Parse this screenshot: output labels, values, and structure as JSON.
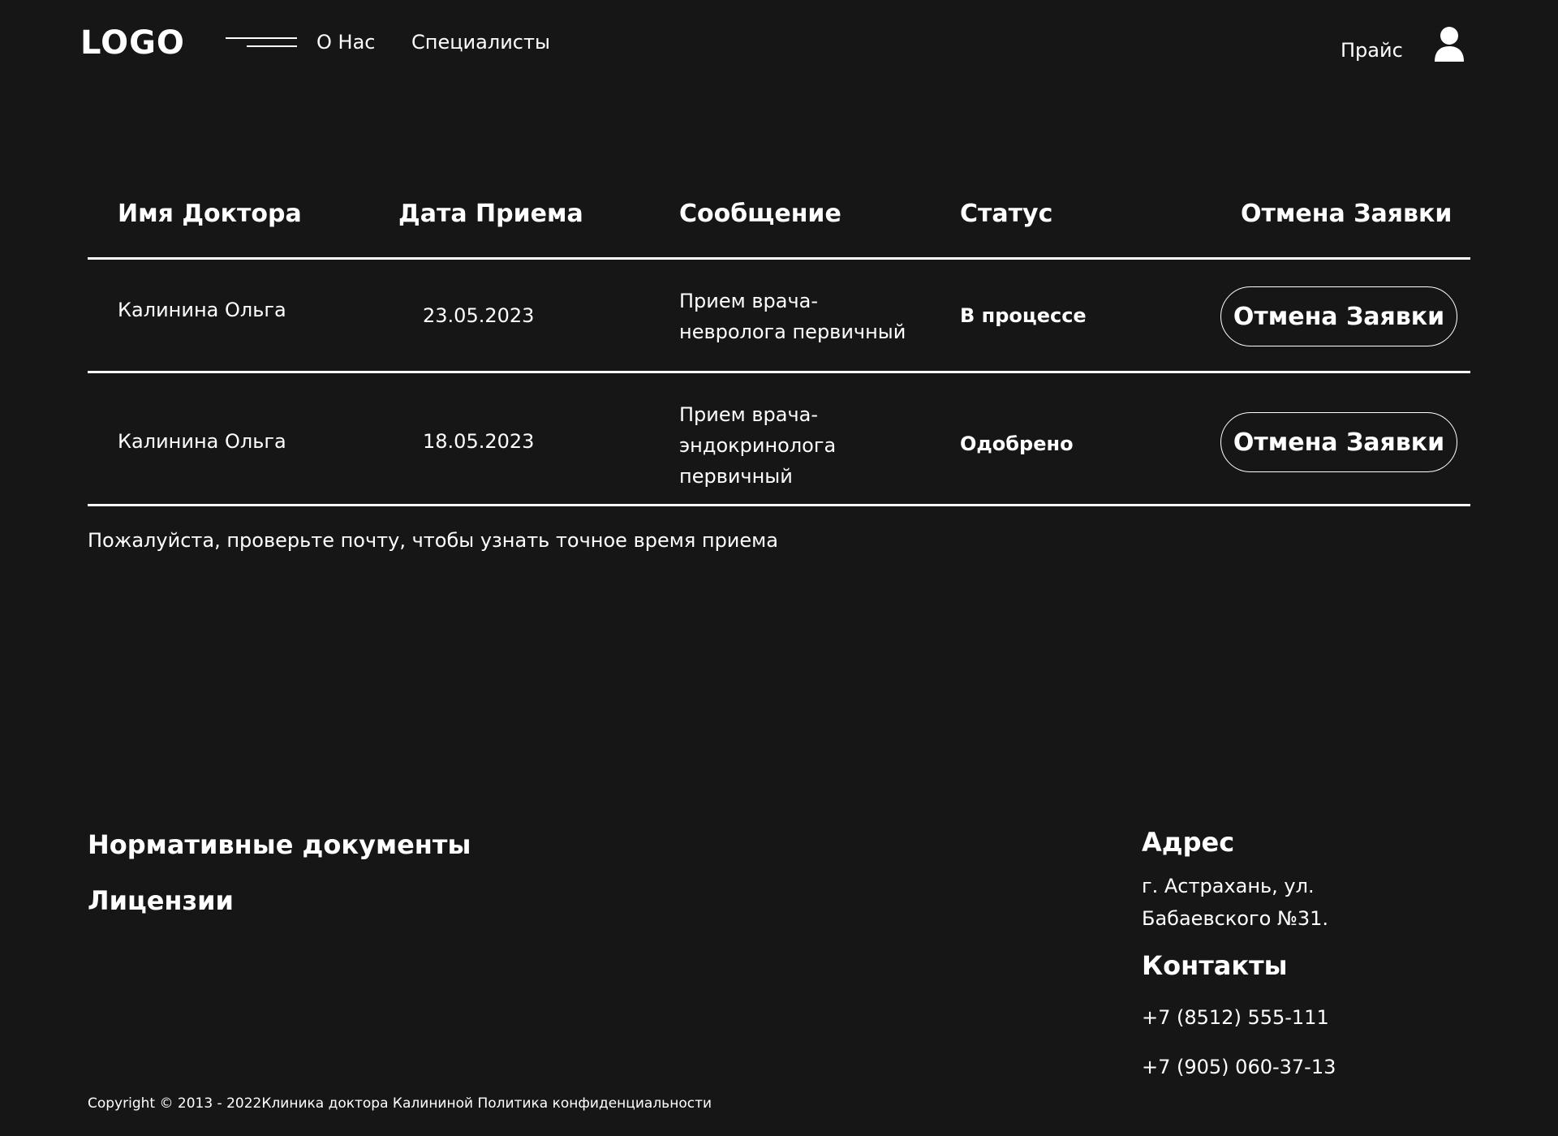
{
  "header": {
    "logo": "LOGO",
    "nav": [
      "О Нас",
      "Специалисты"
    ],
    "price": "Прайс"
  },
  "table": {
    "columns": [
      "Имя Доктора",
      "Дата Приема",
      "Сообщение",
      "Статус",
      "Отмена Заявки"
    ],
    "rows": [
      {
        "doctor": "Калинина Ольга",
        "date": "23.05.2023",
        "message": "Прием врача-невролога первичный",
        "status": "В процессе",
        "cancel_label": "Отмена Заявки"
      },
      {
        "doctor": "Калинина Ольга",
        "date": "18.05.2023",
        "message": "Прием врача-эндокринолога первичный",
        "status": "Одобрено",
        "cancel_label": "Отмена Заявки"
      }
    ]
  },
  "note": "Пожалуйста, проверьте почту, чтобы узнать точное время приема",
  "footer": {
    "links": [
      "Нормативные документы",
      "Лицензии"
    ],
    "address_title": "Адрес",
    "address": "г. Астрахань, ул. Бабаевского №31.",
    "contacts_title": "Контакты",
    "phones": [
      "+7 (8512) 555-111",
      "+7 (905) 060-37-13"
    ],
    "copyright": "Copyright © 2013 - 2022Клиника доктора Калининой Политика конфиденциальности"
  },
  "colors": {
    "background": "#161616",
    "text": "#ffffff"
  },
  "icons": {
    "menu": "menu-lines-icon",
    "user": "user-icon"
  }
}
